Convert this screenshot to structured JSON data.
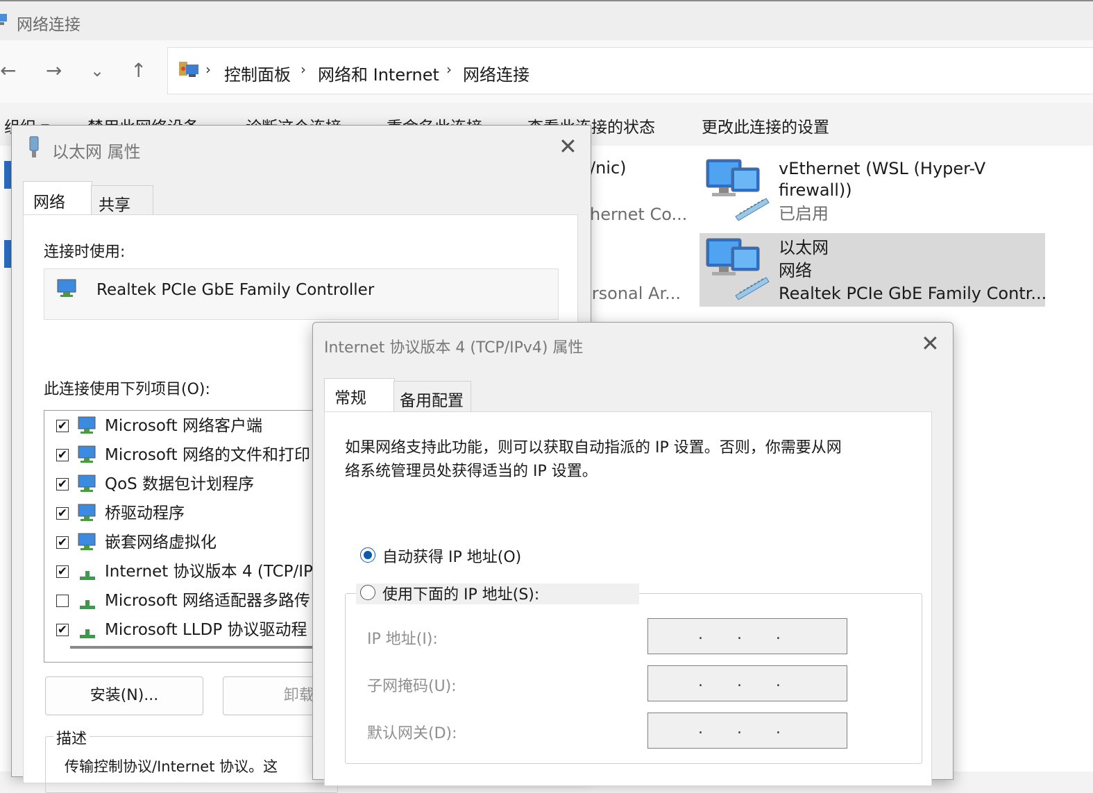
{
  "window": {
    "title": "网络连接"
  },
  "nav": {
    "back": "←",
    "forward": "→",
    "dropdown": "⌄",
    "up": "↑"
  },
  "breadcrumb": [
    "控制面板",
    "网络和 Internet",
    "网络连接"
  ],
  "commands": [
    "组织 ▾",
    "禁用此网络设备",
    "诊断这个连接",
    "重命名此连接",
    "查看此连接的状态",
    "更改此连接的设置"
  ],
  "connections": {
    "partial1_line1": "/nic)",
    "partial1_line2": "hernet Co...",
    "partial2_line3": "ersonal Ar...",
    "wsl": {
      "name_line1": "vEthernet (WSL (Hyper-V",
      "name_line2": "firewall))",
      "status": "已启用"
    },
    "ethernet": {
      "name": "以太网",
      "network": "网络",
      "adapter": "Realtek PCIe GbE Family Contr..."
    }
  },
  "ethernet_dialog": {
    "title": "以太网 属性",
    "close": "✕",
    "tabs": [
      "网络",
      "共享"
    ],
    "connect_using_label": "连接时使用:",
    "adapter": "Realtek PCIe GbE Family Controller",
    "items_label": "此连接使用下列项目(O):",
    "items": [
      {
        "checked": true,
        "label": "Microsoft 网络客户端"
      },
      {
        "checked": true,
        "label": "Microsoft 网络的文件和打印"
      },
      {
        "checked": true,
        "label": "QoS 数据包计划程序"
      },
      {
        "checked": true,
        "label": "桥驱动程序"
      },
      {
        "checked": true,
        "label": "嵌套网络虚拟化"
      },
      {
        "checked": true,
        "label": "Internet 协议版本 4 (TCP/IP"
      },
      {
        "checked": false,
        "label": "Microsoft 网络适配器多路传"
      },
      {
        "checked": true,
        "label": "Microsoft LLDP 协议驱动程"
      }
    ],
    "install_button": "安装(N)...",
    "uninstall_button": "卸载(",
    "description_label": "描述",
    "description_text": "传输控制协议/Internet 协议。这"
  },
  "ipv4_dialog": {
    "title": "Internet 协议版本 4 (TCP/IPv4) 属性",
    "close": "✕",
    "tabs": [
      "常规",
      "备用配置"
    ],
    "intro_line1": "如果网络支持此功能，则可以获取自动指派的 IP 设置。否则，你需要从网",
    "intro_line2": "络系统管理员处获得适当的 IP 设置。",
    "auto_ip": "自动获得 IP 地址(O)",
    "manual_ip": "使用下面的 IP 地址(S):",
    "fields": [
      "IP 地址(I):",
      "子网掩码(U):",
      "默认网关(D):"
    ],
    "ip_dots": ".       .       ."
  }
}
